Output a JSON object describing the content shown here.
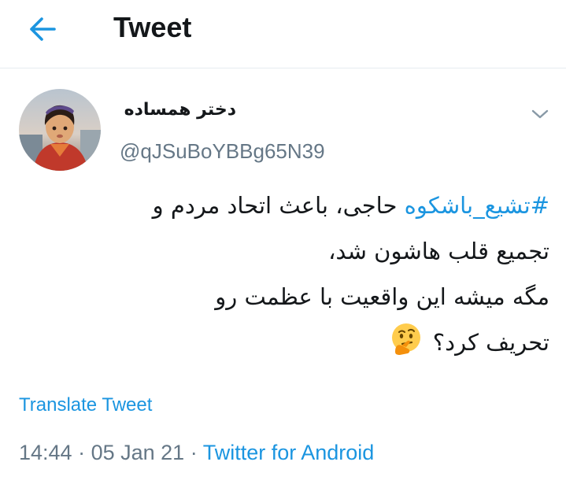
{
  "header": {
    "title": "Tweet",
    "back_icon": "arrow-left-icon"
  },
  "tweet": {
    "author": {
      "display_name": "دختر همساده",
      "handle": "@qJSuBoYBBg65N39",
      "avatar_icon": "avatar-image"
    },
    "menu_icon": "chevron-down-icon",
    "body": {
      "hashtag": "#تشیع_باشکوه",
      "line1_rest": " حاجی، باعث اتحاد مردم و",
      "line2": "تجمیع قلب هاشون شد،",
      "line3": "مگه میشه این واقعیت با عظمت رو",
      "line4": "تحریف کرد؟",
      "emoji": "thinking-face-emoji"
    },
    "translate_label": "Translate Tweet",
    "time": "14:44",
    "separator": " · ",
    "date": "05 Jan 21",
    "source": "Twitter for Android"
  },
  "colors": {
    "accent": "#1b95e0",
    "secondary_text": "#657786",
    "primary_text": "#14171a",
    "divider": "#e6ecf0"
  }
}
